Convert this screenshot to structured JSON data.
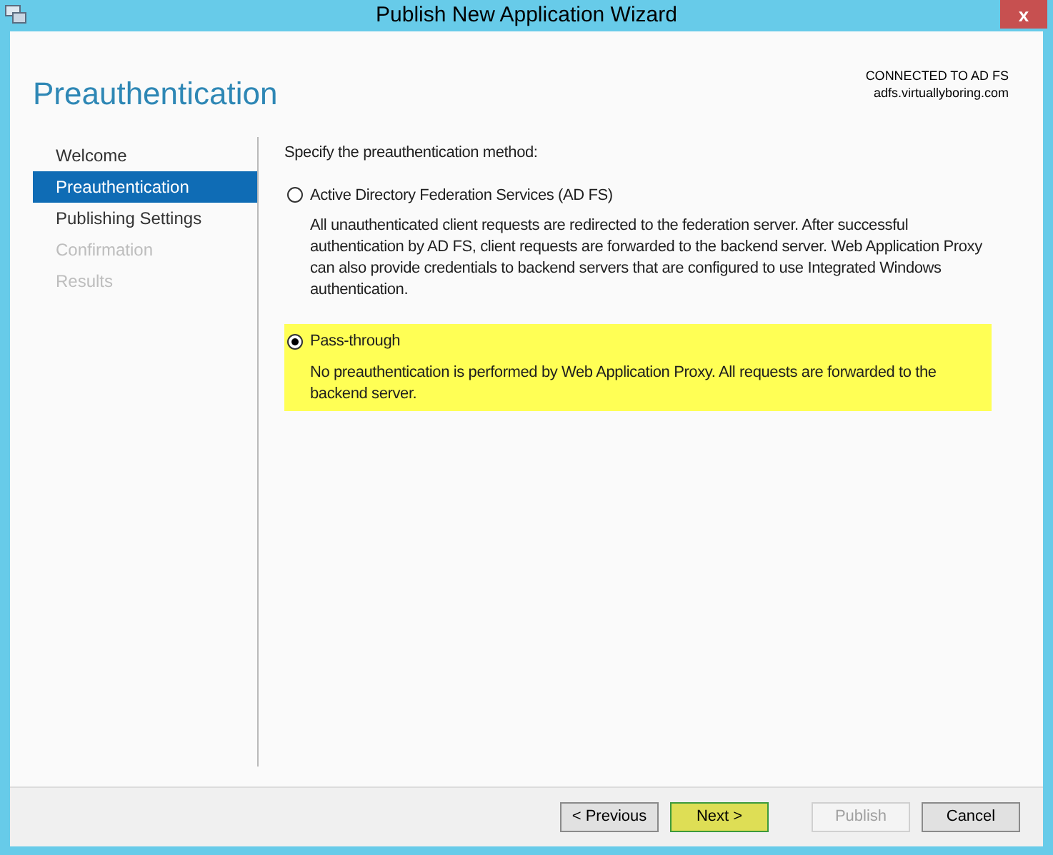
{
  "window": {
    "title": "Publish New Application Wizard",
    "close": "x"
  },
  "header": {
    "title": "Preauthentication",
    "connection_status": "CONNECTED TO AD FS",
    "server": "adfs.virtuallyboring.com"
  },
  "steps": [
    {
      "label": "Welcome",
      "selected": false,
      "disabled": false
    },
    {
      "label": "Preauthentication",
      "selected": true,
      "disabled": false
    },
    {
      "label": "Publishing Settings",
      "selected": false,
      "disabled": false
    },
    {
      "label": "Confirmation",
      "selected": false,
      "disabled": true
    },
    {
      "label": "Results",
      "selected": false,
      "disabled": true
    }
  ],
  "prompt": "Specify the preauthentication method:",
  "options": [
    {
      "label": "Active Directory Federation Services (AD FS)",
      "description": "All unauthenticated client requests are redirected to the federation server. After successful authentication by AD FS, client requests are forwarded to the backend server. Web Application Proxy can also provide credentials to backend servers that are configured to use Integrated Windows authentication.",
      "selected": false,
      "highlighted": false
    },
    {
      "label": "Pass-through",
      "description": "No preauthentication is performed by Web Application Proxy. All requests are forwarded to the backend server.",
      "selected": true,
      "highlighted": true
    }
  ],
  "buttons": [
    {
      "label": "< Previous",
      "disabled": false,
      "highlighted": false
    },
    {
      "label": "Next >",
      "disabled": false,
      "highlighted": true
    },
    {
      "label": "Publish",
      "disabled": true,
      "highlighted": false
    },
    {
      "label": "Cancel",
      "disabled": false,
      "highlighted": false
    }
  ]
}
